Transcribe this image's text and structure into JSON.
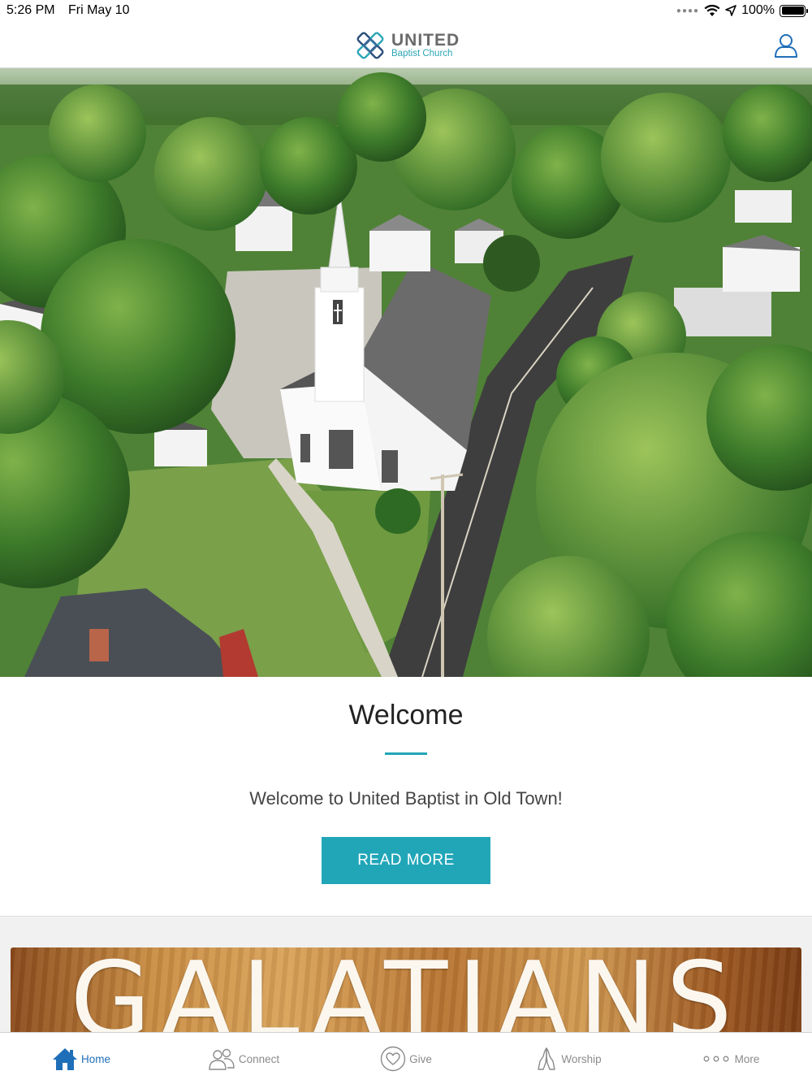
{
  "status_bar": {
    "time": "5:26 PM",
    "date": "Fri May 10",
    "battery": "100%",
    "battery_level": 1.0
  },
  "header": {
    "logo_title": "UNITED",
    "logo_subtitle": "Baptist Church",
    "profile_icon": "person-icon"
  },
  "hero": {
    "image_subject": "aerial-church-photo"
  },
  "welcome": {
    "title": "Welcome",
    "text": "Welcome to United Baptist in Old Town!",
    "button_label": "READ MORE",
    "accent_color": "#21a6b8"
  },
  "sermon": {
    "title": "GALATIANS"
  },
  "tab_bar": {
    "active_color": "#1f6fb8",
    "tabs": [
      {
        "label": "Home",
        "icon": "home-icon",
        "active": true
      },
      {
        "label": "Connect",
        "icon": "people-icon",
        "active": false
      },
      {
        "label": "Give",
        "icon": "heart-icon",
        "active": false
      },
      {
        "label": "Worship",
        "icon": "praying-hands-icon",
        "active": false
      },
      {
        "label": "More",
        "icon": "more-dots-icon",
        "active": false
      }
    ]
  }
}
